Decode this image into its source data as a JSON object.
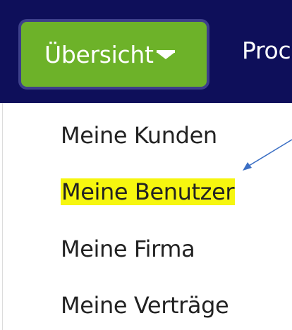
{
  "navbar": {
    "overview_label": "Übersicht",
    "next_label": "Proc"
  },
  "dropdown": {
    "items": [
      {
        "label": "Meine Kunden",
        "highlighted": false
      },
      {
        "label": "Meine Benutzer",
        "highlighted": true
      },
      {
        "label": "Meine Firma",
        "highlighted": false
      },
      {
        "label": "Meine Verträge",
        "highlighted": false
      }
    ]
  },
  "colors": {
    "navbar_bg": "#0e0f5a",
    "button_green": "#6db229",
    "highlight_yellow": "#f6f60f",
    "arrow_blue": "#3b6fc4"
  }
}
